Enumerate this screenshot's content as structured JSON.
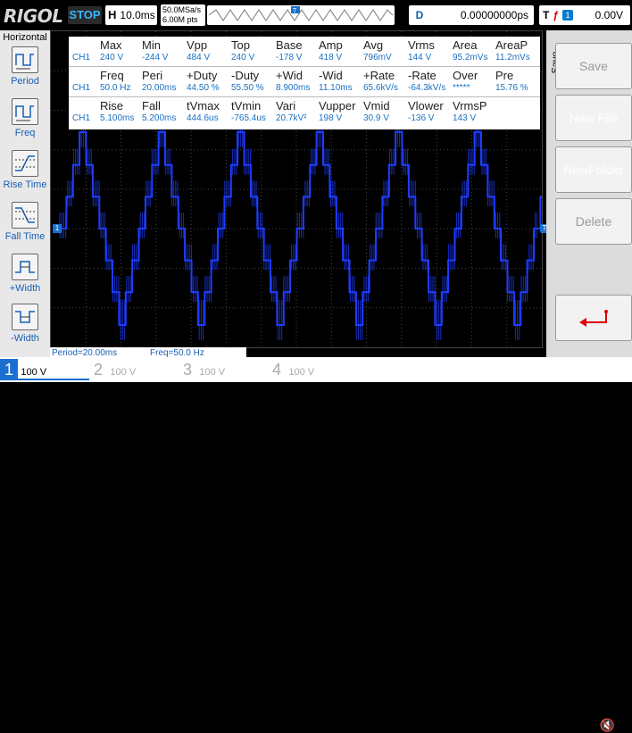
{
  "app": {
    "brand": "RIGOL",
    "run_state": "STOP"
  },
  "timebase": {
    "label": "H",
    "value": "10.0ms"
  },
  "sampling": {
    "rate": "50.0MSa/s",
    "points": "6.00M pts"
  },
  "delay": {
    "label": "D",
    "value": "0.00000000ps"
  },
  "trigger": {
    "label": "T",
    "source": "1",
    "level": "0.00V"
  },
  "left_menu": {
    "title": "Horizontal",
    "items": [
      {
        "label": "Period",
        "icon": "period-icon"
      },
      {
        "label": "Freq",
        "icon": "freq-icon"
      },
      {
        "label": "Rise Time",
        "icon": "rise-time-icon"
      },
      {
        "label": "Fall Time",
        "icon": "fall-time-icon"
      },
      {
        "label": "+Width",
        "icon": "positive-width-icon"
      },
      {
        "label": "-Width",
        "icon": "negative-width-icon"
      }
    ]
  },
  "measurements": {
    "rows": [
      {
        "headers": [
          "Max",
          "Min",
          "Vpp",
          "Top",
          "Base",
          "Amp",
          "Avg",
          "Vrms",
          "Area",
          "AreaP"
        ],
        "channel": "CH1",
        "values": [
          "240 V",
          "-244 V",
          "484 V",
          "240 V",
          "-178 V",
          "418 V",
          "796mV",
          "144 V",
          "95.2mVs",
          "11.2mVs"
        ]
      },
      {
        "headers": [
          "Freq",
          "Peri",
          "+Duty",
          "-Duty",
          "+Wid",
          "-Wid",
          "+Rate",
          "-Rate",
          "Over",
          "Pre"
        ],
        "channel": "CH1",
        "values": [
          "50.0 Hz",
          "20.00ms",
          "44.50 %",
          "55.50 %",
          "8.900ms",
          "11.10ms",
          "65.6kV/s",
          "-64.3kV/s",
          "*****",
          "15.76 %"
        ]
      },
      {
        "headers": [
          "Rise",
          "Fall",
          "tVmax",
          "tVmin",
          "Vari",
          "Vupper",
          "Vmid",
          "Vlower",
          "VrmsP"
        ],
        "channel": "CH1",
        "values": [
          "5.100ms",
          "5.200ms",
          "444.6us",
          "-765.4us",
          "20.7kV²",
          "198 V",
          "30.9 V",
          "-136 V",
          "143 V"
        ]
      }
    ]
  },
  "bottom_meas": {
    "period": "Period=20.00ms",
    "freq": "Freq=50.0 Hz"
  },
  "right_menu": {
    "section": "Save",
    "buttons": [
      "Save",
      "New File",
      "NewFolder",
      "Delete"
    ]
  },
  "channels": [
    {
      "num": "1",
      "scale": "100 V",
      "active": true
    },
    {
      "num": "2",
      "scale": "100 V",
      "active": false
    },
    {
      "num": "3",
      "scale": "100 V",
      "active": false
    },
    {
      "num": "4",
      "scale": "100 V",
      "active": false
    }
  ],
  "colors": {
    "ch1": "#1f3dff",
    "accent": "#33b6ff",
    "trigger_marker": "#1a6fd0"
  }
}
